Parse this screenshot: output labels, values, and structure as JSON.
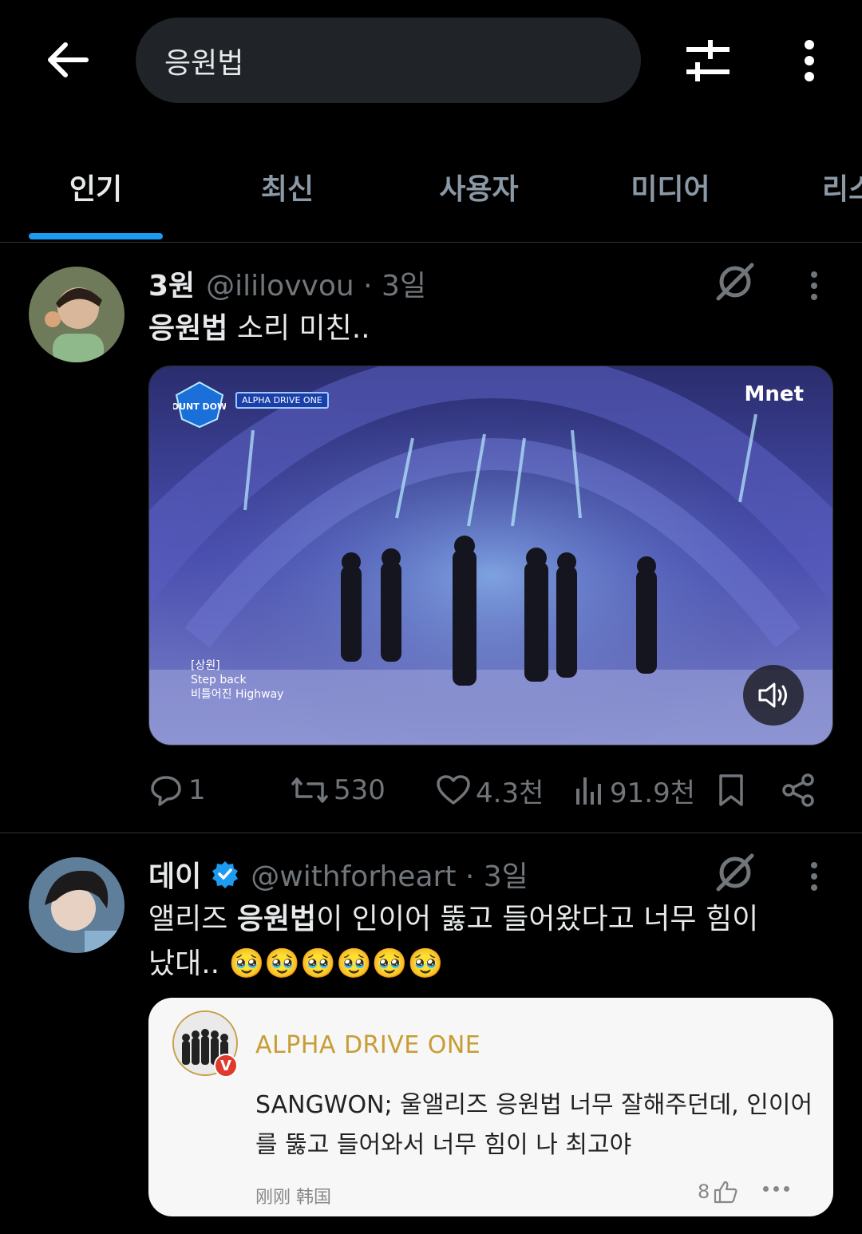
{
  "search": {
    "query": "응원법"
  },
  "tabs": [
    {
      "label": "인기",
      "active": true
    },
    {
      "label": "최신",
      "active": false
    },
    {
      "label": "사용자",
      "active": false
    },
    {
      "label": "미디어",
      "active": false
    },
    {
      "label": "리스",
      "active": false
    }
  ],
  "accent_color": "#1d9bf0",
  "posts": [
    {
      "name": "3원",
      "handle": "@ililovvou · 3일",
      "text_highlight": "응원법",
      "text_rest": " 소리 미친..",
      "media": {
        "type": "video",
        "channel_logo": "Mnet",
        "show_logo": "COUNT DOWN",
        "caption_banner": "ALPHA DRIVE ONE",
        "stage_caption_1": "[상원]",
        "stage_caption_2": "Step back",
        "stage_caption_3": "비틀어진 Highway",
        "sound_icon": "speaker-icon"
      },
      "stats": {
        "replies": "1",
        "reposts": "530",
        "likes": "4.3천",
        "views": "91.9천"
      }
    },
    {
      "name": "데이",
      "verified": true,
      "handle": "@withforheart · 3일",
      "text_part1": "앨리즈 ",
      "text_highlight": "응원법",
      "text_part2": "이 인이어 뚫고 들어왔다고 너무 힘이 났대.. 🥹🥹🥹🥹🥹🥹",
      "quote": {
        "name": "ALPHA DRIVE ONE",
        "badge": "V",
        "text": "SANGWON; 울앨리즈 응원법 너무 잘해주던데, 인이어를 뚫고 들어와서 너무 힘이 나 최고야",
        "meta": "刚刚  韩国",
        "likes": "8"
      }
    }
  ]
}
